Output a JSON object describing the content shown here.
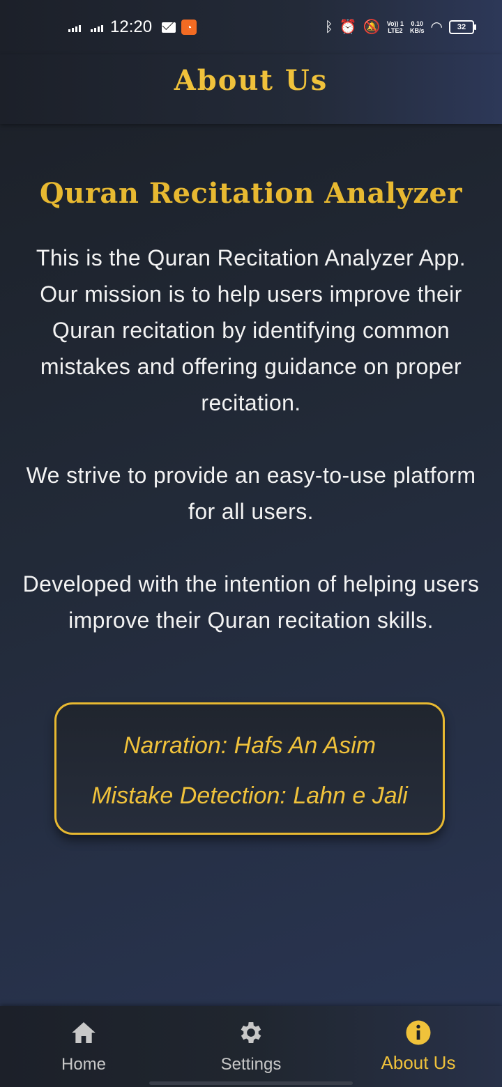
{
  "status_bar": {
    "time": "12:20",
    "battery": "32",
    "speed_value": "0.10",
    "speed_unit": "KB/s",
    "volte_line1": "Vo)) 1",
    "volte_line2": "LTE2"
  },
  "header": {
    "title": "About Us"
  },
  "main": {
    "app_title": "Quran Recitation Analyzer",
    "paragraphs": [
      "This is the Quran Recitation Analyzer App. Our mission is to help users improve their Quran recitation by identifying common mistakes and offering guidance on proper recitation.",
      "We strive to provide an easy-to-use platform for all users.",
      "Developed with the intention of helping users improve their Quran recitation skills."
    ],
    "info_card": {
      "narration": "Narration: Hafs An Asim",
      "mistake_detection": "Mistake Detection: Lahn e Jali"
    }
  },
  "bottom_nav": {
    "items": [
      {
        "label": "Home",
        "icon": "home-icon",
        "active": false
      },
      {
        "label": "Settings",
        "icon": "gear-icon",
        "active": false
      },
      {
        "label": "About Us",
        "icon": "info-icon",
        "active": true
      }
    ]
  },
  "colors": {
    "accent": "#f0c23b",
    "background": "#222a38",
    "text": "#f3f3f3",
    "inactive_nav": "#c8c8c8"
  }
}
